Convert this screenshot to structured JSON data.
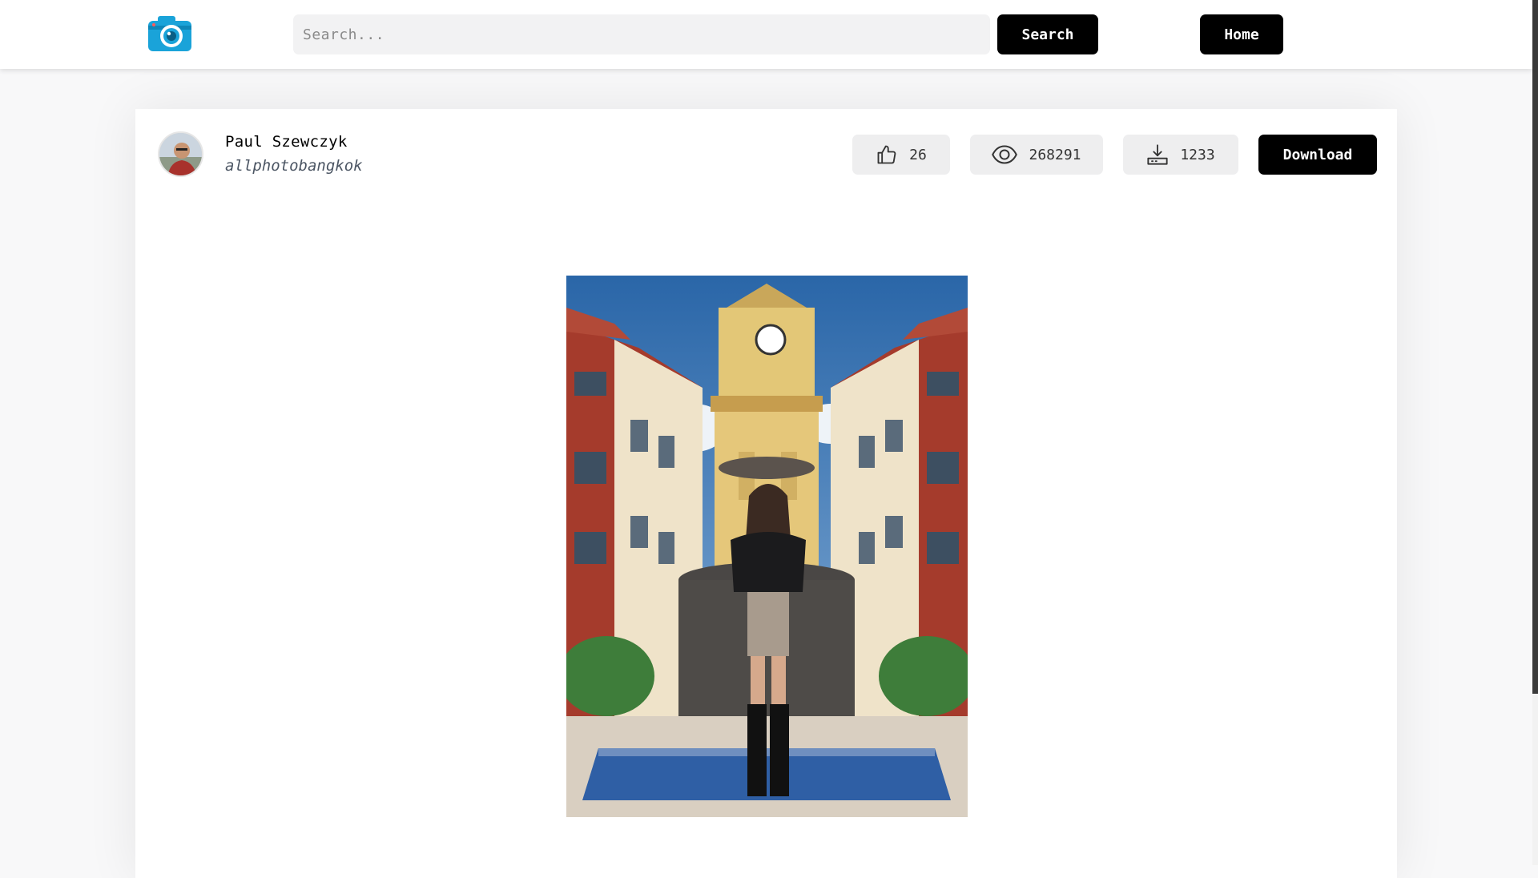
{
  "header": {
    "search_placeholder": "Search...",
    "search_button": "Search",
    "home_button": "Home"
  },
  "photo": {
    "author_name": "Paul Szewczyk",
    "author_handle": "allphotobangkok",
    "likes": "26",
    "views": "268291",
    "downloads": "1233",
    "download_button": "Download"
  },
  "colors": {
    "accent": "#000000",
    "logo_blue": "#1aa3d9",
    "stat_bg": "#eeeeef"
  },
  "icons": [
    "camera-logo-icon",
    "thumbs-up-icon",
    "eye-icon",
    "download-tray-icon"
  ]
}
